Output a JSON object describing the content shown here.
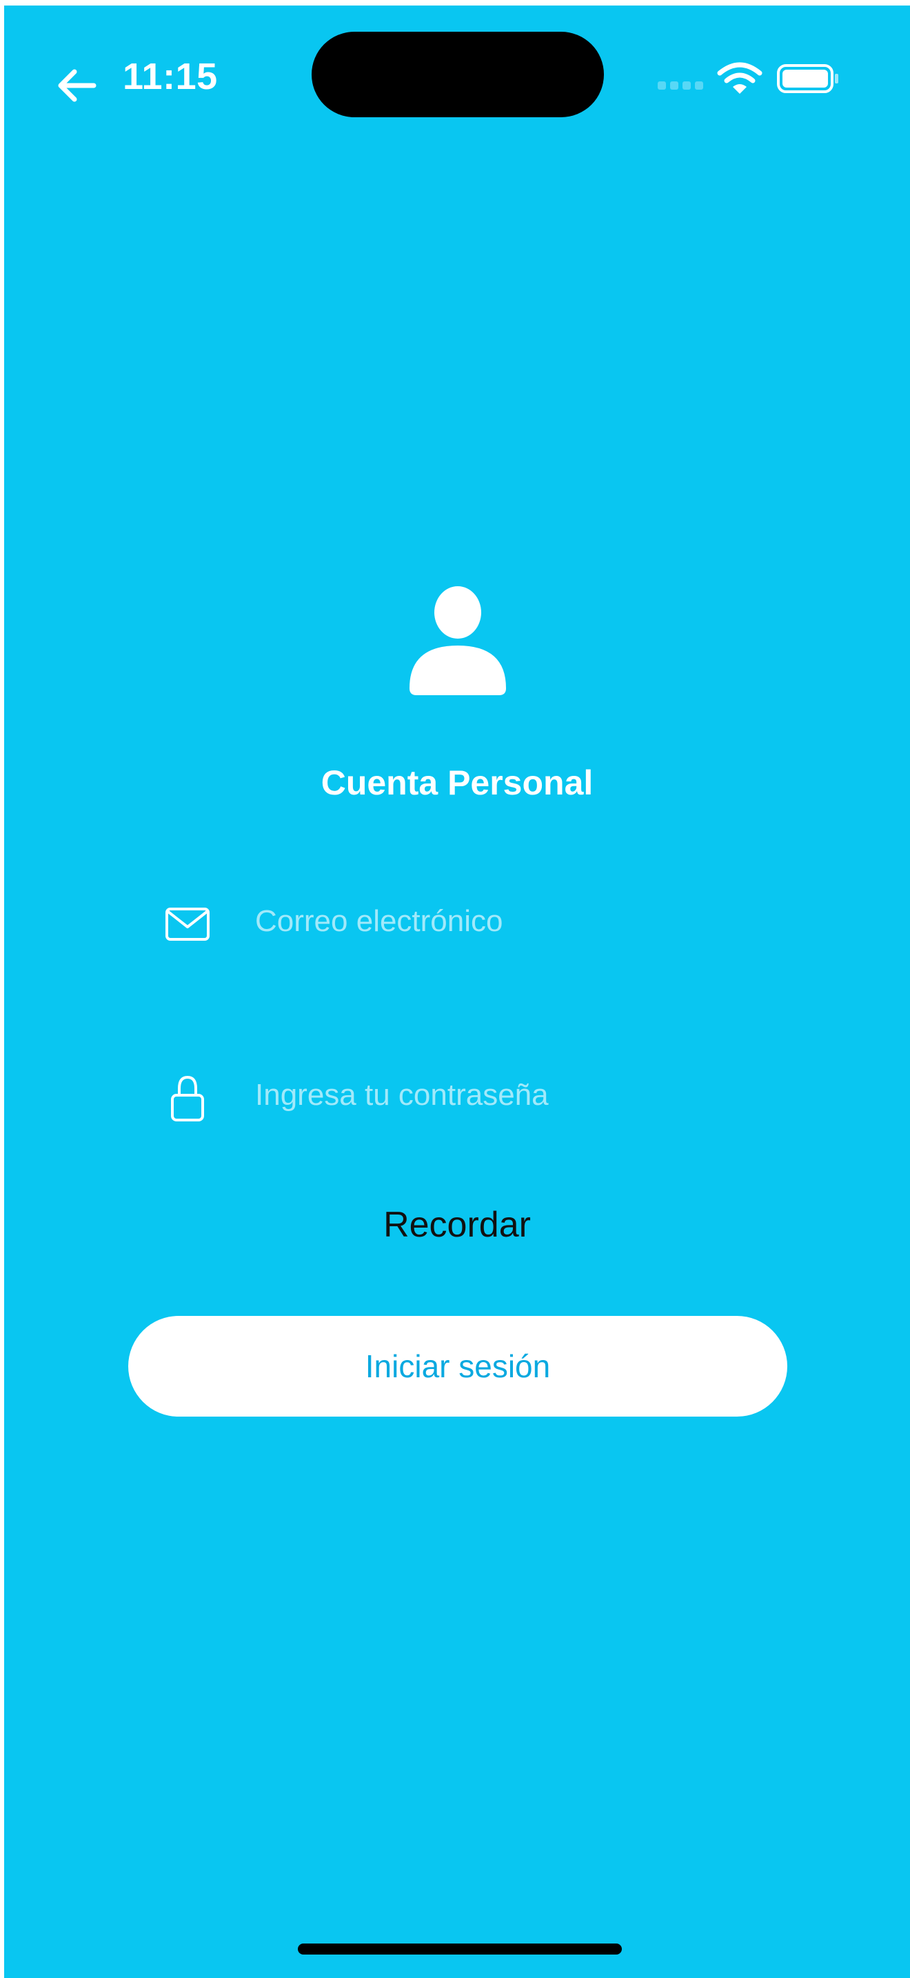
{
  "status_bar": {
    "time": "11:15",
    "icons": [
      "back-arrow-icon",
      "cellular-signal-icon",
      "wifi-icon",
      "battery-icon"
    ]
  },
  "colors": {
    "background": "#09C6F1",
    "button_background": "#FFFFFF",
    "button_text": "#09A9E0",
    "remember_text": "#111111"
  },
  "login": {
    "icon": "person-icon",
    "title": "Cuenta Personal",
    "email": {
      "icon": "mail-icon",
      "placeholder": "Correo electrónico",
      "value": ""
    },
    "password": {
      "icon": "lock-icon",
      "placeholder": "Ingresa tu contraseña",
      "value": ""
    },
    "remember_label": "Recordar",
    "submit_label": "Iniciar sesión"
  }
}
